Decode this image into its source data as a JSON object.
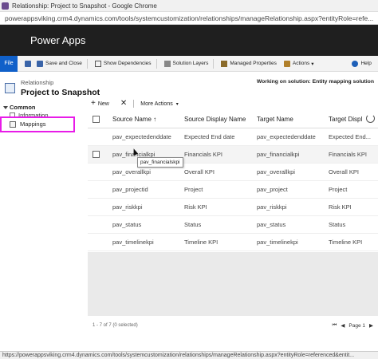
{
  "window": {
    "title": "Relationship: Project to Snapshot - Google Chrome"
  },
  "browser": {
    "url": "powerappsviking.crm4.dynamics.com/tools/systemcustomization/relationships/manageRelationship.aspx?entityRole=refe..."
  },
  "appbar": {
    "app_name": "Power Apps"
  },
  "commandbar": {
    "file": "File",
    "save_and_close": "Save and Close",
    "show_dependencies": "Show Dependencies",
    "solution_layers": "Solution Layers",
    "managed_properties": "Managed Properties",
    "actions": "Actions",
    "help": "Help"
  },
  "header": {
    "entity_label": "Relationship",
    "title": "Project to Snapshot",
    "solution_note": "Working on solution: Entity mapping solution"
  },
  "leftnav": {
    "section": "Common",
    "items": [
      {
        "label": "Information"
      },
      {
        "label": "Mappings"
      }
    ]
  },
  "grid_toolbar": {
    "new": "New",
    "more_actions": "More Actions"
  },
  "grid": {
    "columns": [
      "Source Name ↑",
      "Source Display Name",
      "Target Name",
      "Target Displ"
    ],
    "rows": [
      {
        "source_name": "pav_expectedenddate",
        "source_display": "Expected End date",
        "target_name": "pav_expectedenddate",
        "target_display": "Expected End..."
      },
      {
        "source_name": "pav_financialkpi",
        "source_display": "Financials KPI",
        "target_name": "pav_financialkpi",
        "target_display": "Financials KPI"
      },
      {
        "source_name": "pav_overallkpi",
        "source_display": "Overall KPI",
        "target_name": "pav_overallkpi",
        "target_display": "Overall KPI"
      },
      {
        "source_name": "pav_projectid",
        "source_display": "Project",
        "target_name": "pav_project",
        "target_display": "Project"
      },
      {
        "source_name": "pav_riskkpi",
        "source_display": "Risk KPI",
        "target_name": "pav_riskkpi",
        "target_display": "Risk KPI"
      },
      {
        "source_name": "pav_status",
        "source_display": "Status",
        "target_name": "pav_status",
        "target_display": "Status"
      },
      {
        "source_name": "pav_timelinekpi",
        "source_display": "Timeline KPI",
        "target_name": "pav_timelinekpi",
        "target_display": "Timeline KPI"
      }
    ],
    "tooltip": "pav_financialskpi",
    "footer_count": "1 - 7 of 7 (0 selected)",
    "page_label": "Page 1"
  },
  "statusbar": {
    "url": "https://powerappsviking.crm4.dynamics.com/tools/systemcustomization/relationships/manageRelationship.aspx?entityRole=referenced&entit..."
  },
  "colors": {
    "appbar": "#1f1f1f",
    "file_button": "#1060c9",
    "highlight": "#e81ce8"
  }
}
